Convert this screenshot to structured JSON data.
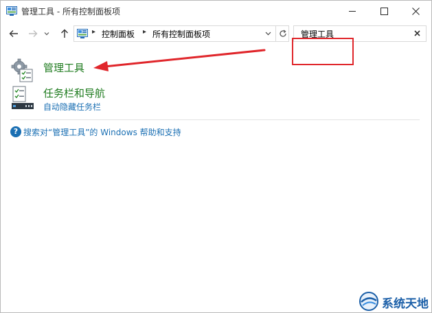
{
  "window": {
    "title": "管理工具 - 所有控制面板项"
  },
  "address": {
    "crumbs": [
      "控制面板",
      "所有控制面板项"
    ]
  },
  "search": {
    "value": "管理工具"
  },
  "results": [
    {
      "title": "管理工具",
      "icon": "admin-tools-icon"
    },
    {
      "title": "任务栏和导航",
      "subtitle": "自动隐藏任务栏",
      "icon": "taskbar-icon"
    }
  ],
  "help": {
    "text": "搜索对“管理工具”的 Windows 帮助和支持"
  },
  "watermark": {
    "text": "系统天地"
  },
  "colors": {
    "link_green": "#1e7b1e",
    "link_blue": "#1a6fb3",
    "annotation_red": "#e0262b"
  }
}
